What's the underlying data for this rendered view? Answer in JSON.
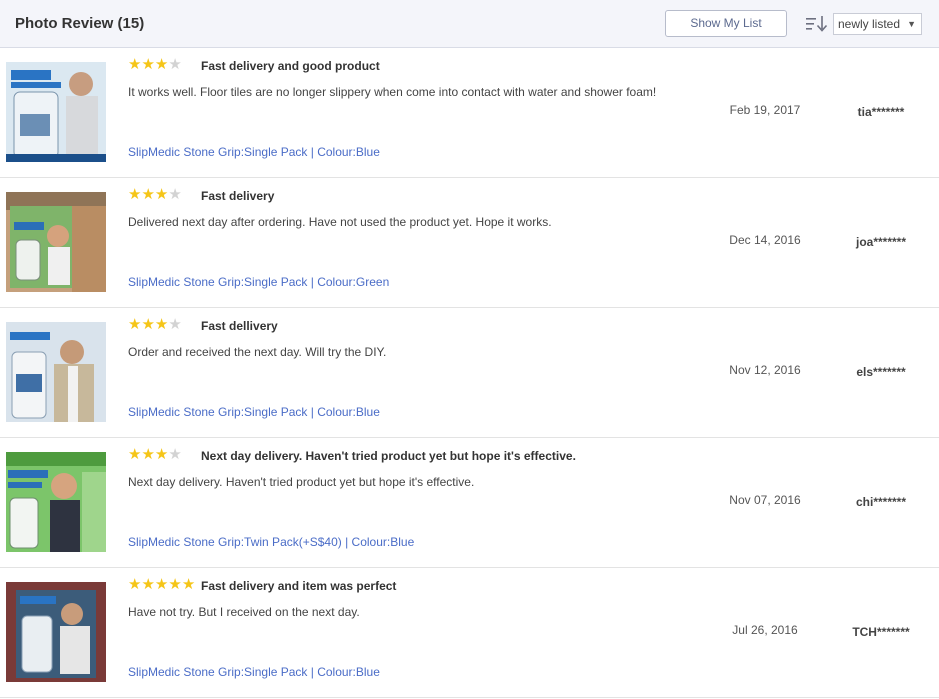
{
  "header": {
    "title": "Photo Review (15)",
    "show_list_label": "Show My List",
    "sort_value": "newly listed"
  },
  "colors": {
    "accent_link": "#4a6cc7",
    "star": "#f5c518",
    "header_bg": "#f4f5fa"
  },
  "reviews": [
    {
      "rating": 3,
      "title": "Fast delivery and good product",
      "body": "It works well. Floor tiles are no longer slippery when come into contact with water and shower foam!",
      "variant": "SlipMedic Stone Grip:Single Pack | Colour:Blue",
      "date": "Feb 19, 2017",
      "user": "tia*******"
    },
    {
      "rating": 3,
      "title": "Fast delivery",
      "body": "Delivered next day after ordering. Have not used the product yet. Hope it works.",
      "variant": "SlipMedic Stone Grip:Single Pack | Colour:Green",
      "date": "Dec 14, 2016",
      "user": "joa*******"
    },
    {
      "rating": 3,
      "title": "Fast dellivery",
      "body": "Order and received the next day. Will try the DIY.",
      "variant": "SlipMedic Stone Grip:Single Pack | Colour:Blue",
      "date": "Nov 12, 2016",
      "user": "els*******"
    },
    {
      "rating": 3,
      "title": "Next day delivery. Haven't tried product yet but hope it's effective.",
      "body": "Next day delivery. Haven't tried product yet but hope it's effective.",
      "variant": "SlipMedic Stone Grip:Twin Pack(+S$40) | Colour:Blue",
      "date": "Nov 07, 2016",
      "user": "chi*******"
    },
    {
      "rating": 5,
      "title": "Fast delivery and item was perfect",
      "body": "Have not try. But I received on the next day.",
      "variant": "SlipMedic Stone Grip:Single Pack | Colour:Blue",
      "date": "Jul 26, 2016",
      "user": "TCH*******"
    }
  ]
}
